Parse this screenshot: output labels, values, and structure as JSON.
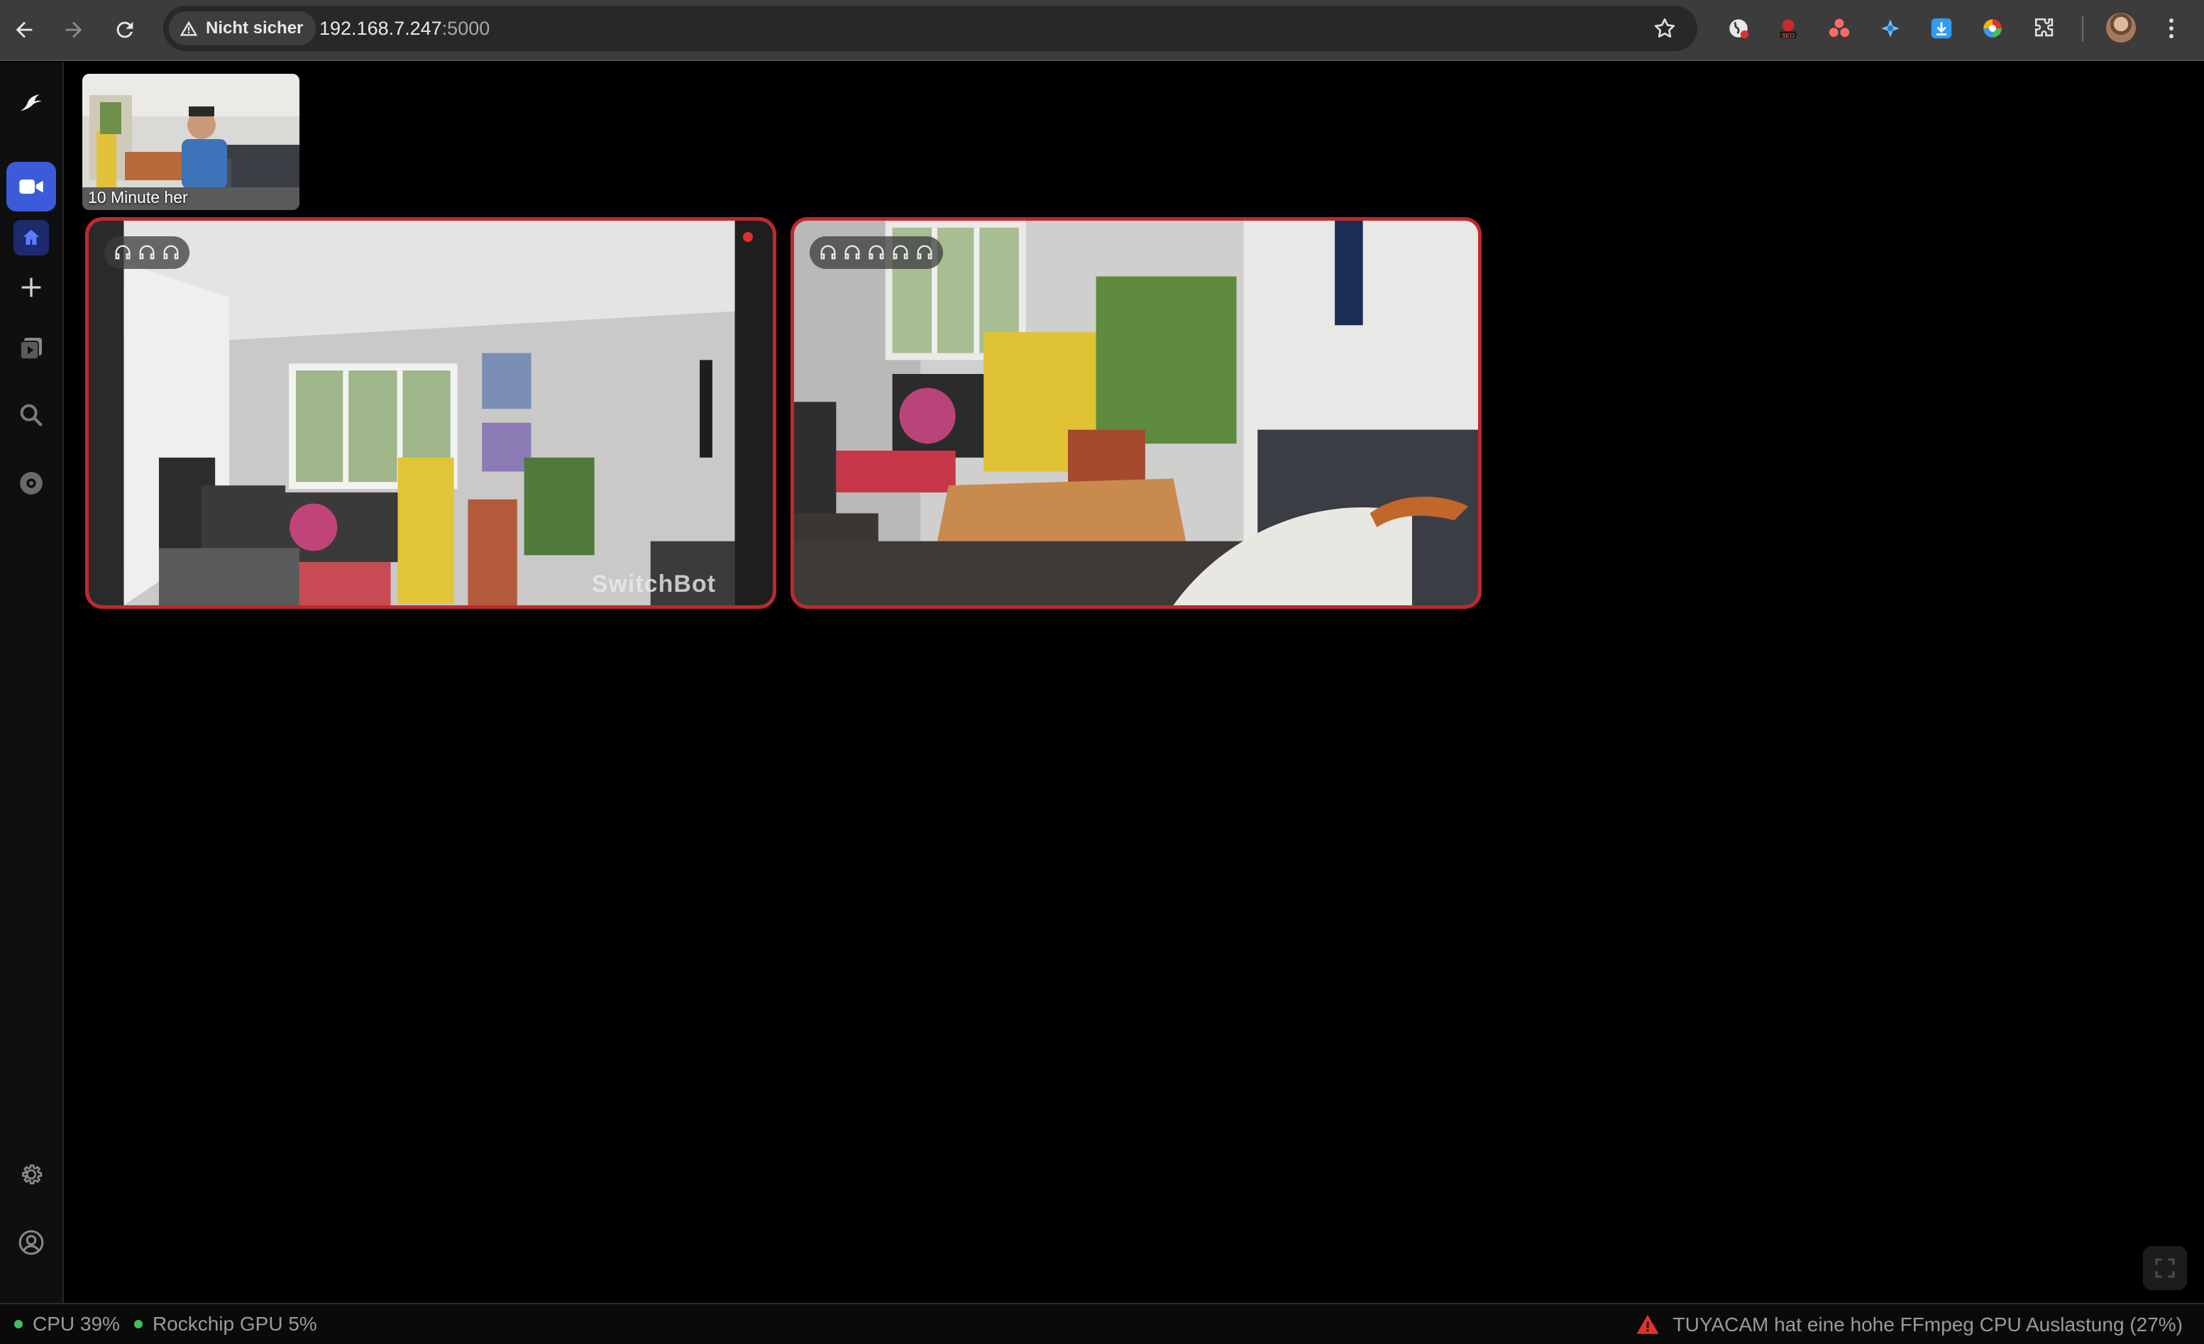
{
  "browser": {
    "security_label": "Nicht sicher",
    "url_host": "192.168.7.247",
    "url_port": ":5000"
  },
  "sidebar": {
    "items": [
      {
        "name": "logo",
        "icon": "bird-logo-icon"
      },
      {
        "name": "live",
        "icon": "video-camera-icon",
        "active": true
      },
      {
        "name": "home",
        "icon": "home-icon",
        "active": true
      },
      {
        "name": "add",
        "icon": "plus-icon"
      },
      {
        "name": "review",
        "icon": "media-library-icon"
      },
      {
        "name": "explore",
        "icon": "search-icon"
      },
      {
        "name": "export",
        "icon": "disc-icon"
      },
      {
        "name": "settings",
        "icon": "gear-icon"
      },
      {
        "name": "account",
        "icon": "user-circle-icon"
      }
    ]
  },
  "recent": {
    "label": "10 Minute her"
  },
  "cameras": [
    {
      "name": "camera-1",
      "watermark": "SwitchBot",
      "status_icons": 3,
      "recording": true
    },
    {
      "name": "camera-2",
      "watermark": "",
      "status_icons": 5,
      "recording": false
    }
  ],
  "statusbar": {
    "cpu": "CPU 39%",
    "gpu": "Rockchip GPU 5%",
    "warning": "TUYACAM hat eine hohe FFmpeg CPU Auslastung (27%)"
  },
  "colors": {
    "accent": "#3b5bdb",
    "camera_border": "#c0282b",
    "ok_dot": "#40c057",
    "warning": "#e03131"
  }
}
